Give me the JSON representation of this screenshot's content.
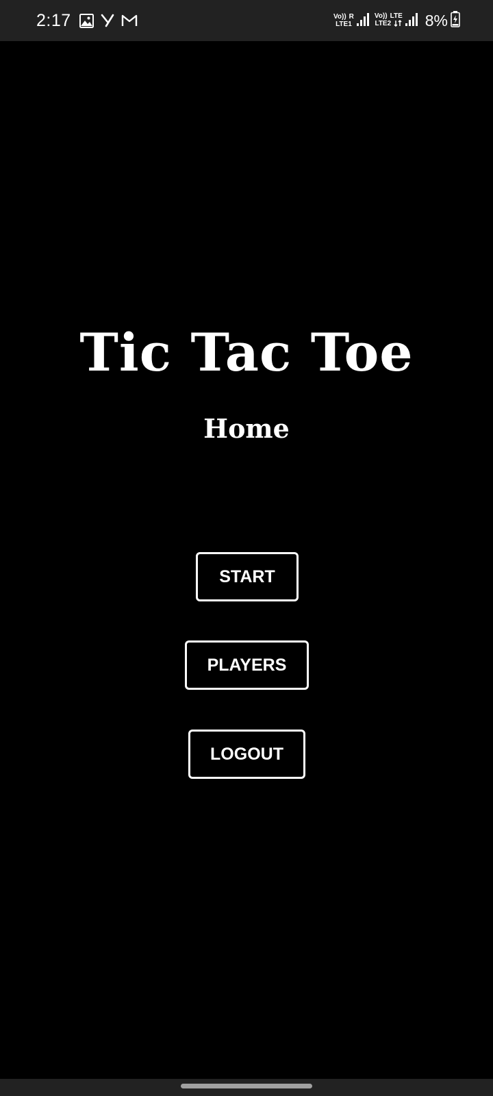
{
  "status_bar": {
    "time": "2:17",
    "left_icons": [
      "gallery-icon",
      "y-app-icon",
      "gmail-icon"
    ],
    "sim1": {
      "volte": "Vo))",
      "roaming": "R",
      "lte": "LTE1"
    },
    "sim2": {
      "volte": "Vo))",
      "lte_top": "LTE",
      "lte": "LTE2"
    },
    "battery": "8%",
    "battery_state": "charging"
  },
  "main": {
    "title": "Tic Tac Toe",
    "subtitle": "Home",
    "buttons": {
      "start": "START",
      "players": "PLAYERS",
      "logout": "LOGOUT"
    }
  },
  "colors": {
    "background": "#000000",
    "status_bar": "#222222",
    "foreground": "#ffffff"
  }
}
